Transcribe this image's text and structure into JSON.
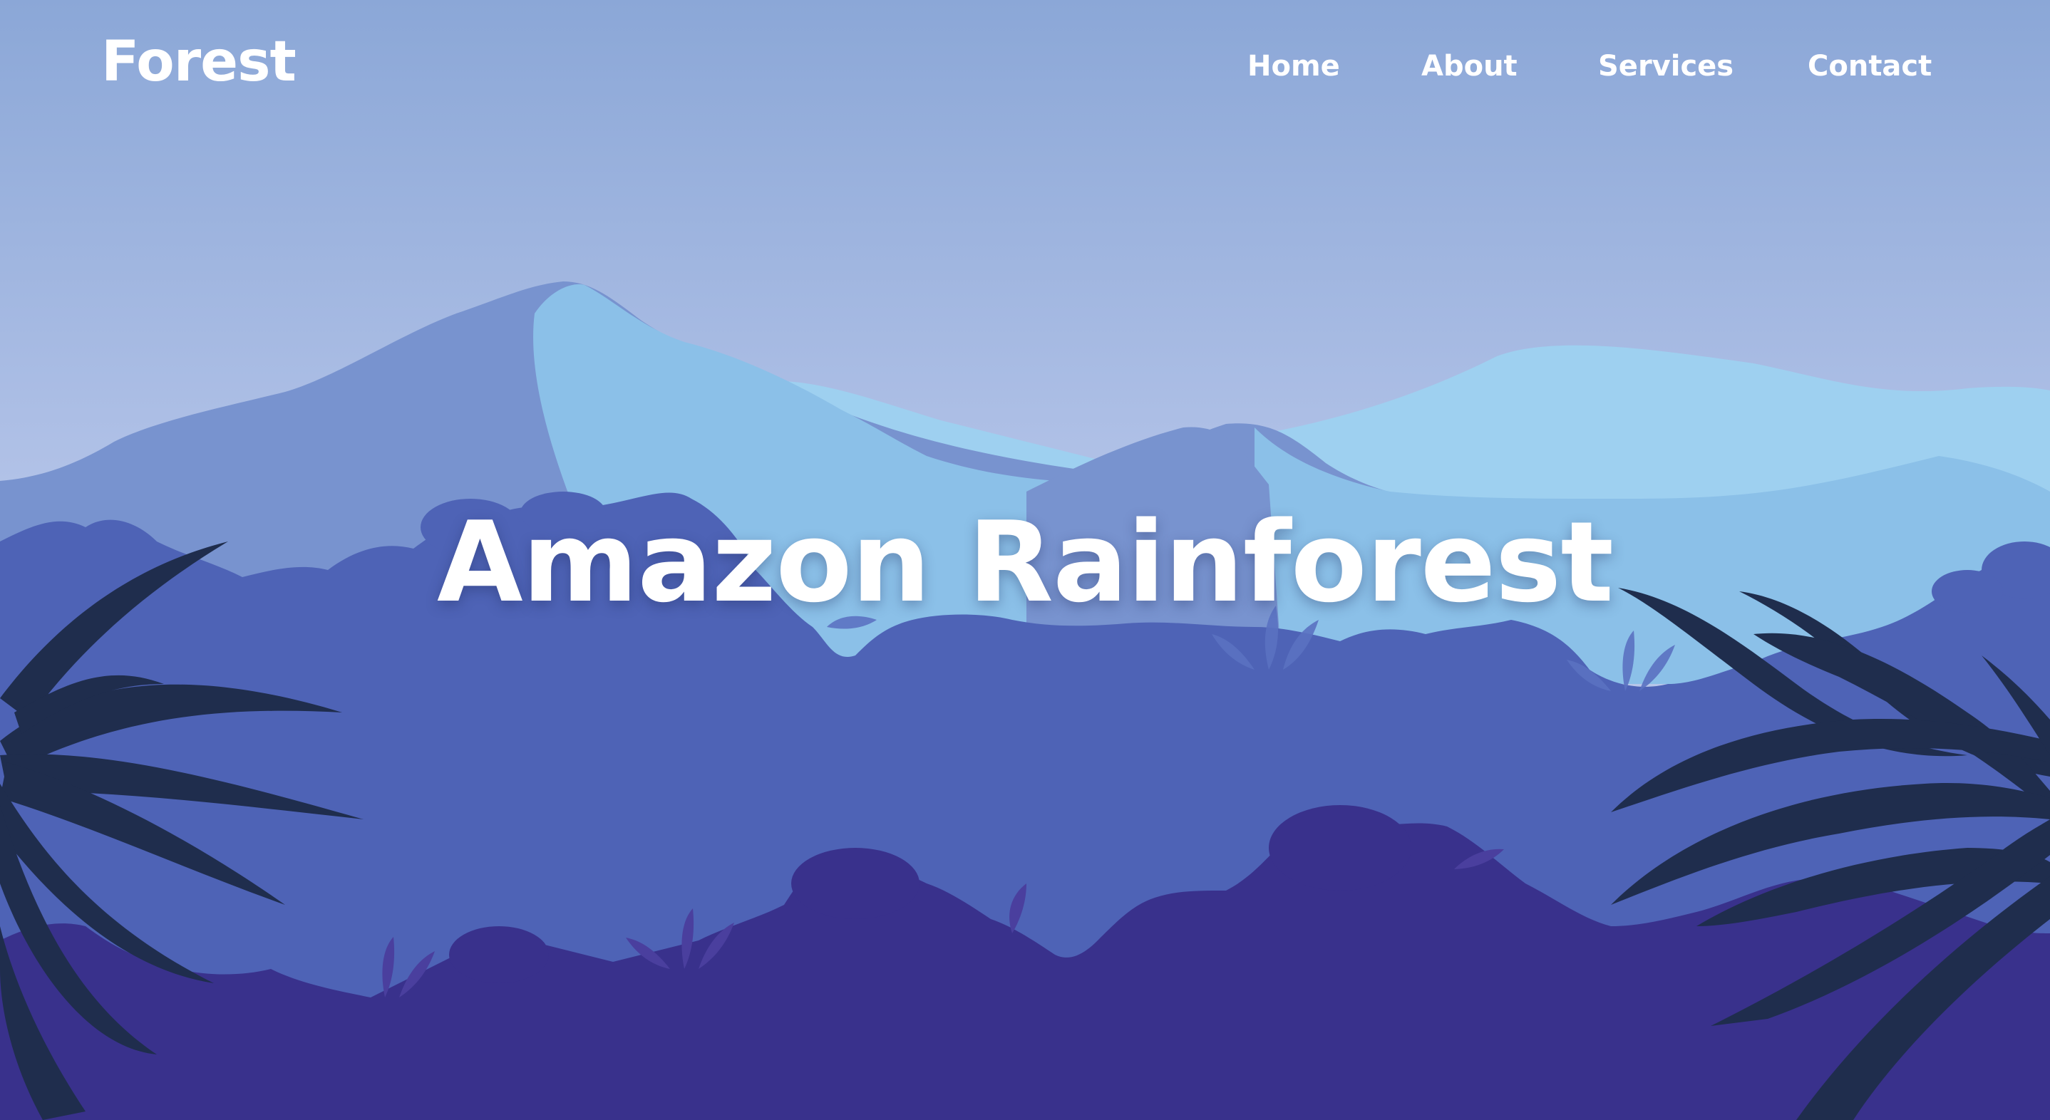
{
  "header": {
    "logo": "Forest",
    "nav": [
      "Home",
      "About",
      "Services",
      "Contact"
    ]
  },
  "hero": {
    "title": "Amazon Rainforest"
  },
  "colors": {
    "sky_top": "#8fa8d8",
    "sky_bottom": "#b8c8ea",
    "mountain_back": "#7893cf",
    "mountain_light": "#8bc0e8",
    "mountain_pale": "#9ed0f0",
    "mid_jungle": "#4e63b6",
    "front_jungle": "#39318c",
    "leaf_dark": "#1f2d4d",
    "text": "#ffffff"
  },
  "illustration": {
    "icons": [
      "mountains-illustration",
      "jungle-canopy-illustration",
      "palm-leaves-left-icon",
      "palm-leaves-right-icon"
    ]
  }
}
